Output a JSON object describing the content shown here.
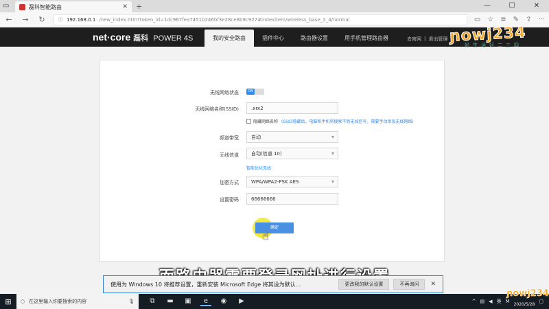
{
  "browser": {
    "tab_title": "磊科智能路由",
    "new_tab": "+",
    "url_host": "192.168.0.1",
    "url_path": "/new_index.htm?token_id=1dc967fea7451b246bf3e28ce8b9c927#indexitem/wireless_base_2_4/normal"
  },
  "header": {
    "logo": "net·core",
    "logo_cn": "磊科",
    "model": "POWER 4S",
    "tabs": [
      {
        "label": "我的安全路由"
      },
      {
        "label": "插件中心"
      },
      {
        "label": "路由器设置"
      },
      {
        "label": "用手机管理路由器"
      }
    ],
    "link_home": "去官网",
    "link_sep": "|",
    "link_logout": "退出管理"
  },
  "watermark": {
    "text": "ɲowj234",
    "sub": "好生活好二三四"
  },
  "form": {
    "status_label": "无线网络状态",
    "status_value": "ON",
    "ssid_label": "无线网络名称(SSID)",
    "ssid_value": ".xrx2",
    "hide_label": "隐藏网络名称",
    "hide_hint": "(SSID隐藏后，电脑和手机将搜索不到无线信号，需要手动添加无线网络)",
    "bandwidth_label": "频道带宽",
    "bandwidth_value": "自动",
    "channel_label": "无线信道",
    "channel_value": "自动(信道 10)",
    "optimize_link": "智能优化无线",
    "encryption_label": "加密方式",
    "encryption_value": "WPA/WPA2-PSK AES",
    "password_label": "设置密码",
    "password_value": "66666666",
    "confirm_label": "确定"
  },
  "notification": {
    "text": "使用为 Windows 10 将推荐设置，重新安装 Microsoft Edge 将其设为默认...",
    "primary_btn": "更改我的默认设置",
    "secondary_btn": "不再询问",
    "close": "✕"
  },
  "subtitle": "而路由器需要登录网址进行设置",
  "taskbar": {
    "search_placeholder": "在这里输入你要搜索的内容",
    "ime": "英",
    "lang": "M",
    "time": "",
    "date": "2020/5/28"
  }
}
